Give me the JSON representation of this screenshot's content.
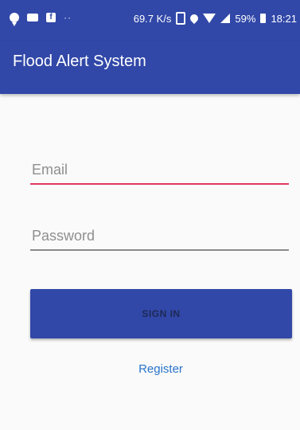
{
  "status_bar": {
    "network_speed": "69.7 K/s",
    "battery": "59%",
    "time": "18:21",
    "icons": [
      "chat-icon",
      "video-icon",
      "facebook-icon",
      "dots-icon",
      "vibrate-icon",
      "location-pin-icon",
      "wifi-icon",
      "signal-icon",
      "battery-icon"
    ]
  },
  "app_bar": {
    "title": "Flood Alert System"
  },
  "form": {
    "email_placeholder": "Email",
    "password_placeholder": "Password",
    "sign_in_label": "SIGN IN",
    "register_label": "Register"
  },
  "colors": {
    "primary": "#3148a8",
    "accent": "#e0395e",
    "link": "#2a74c9"
  }
}
